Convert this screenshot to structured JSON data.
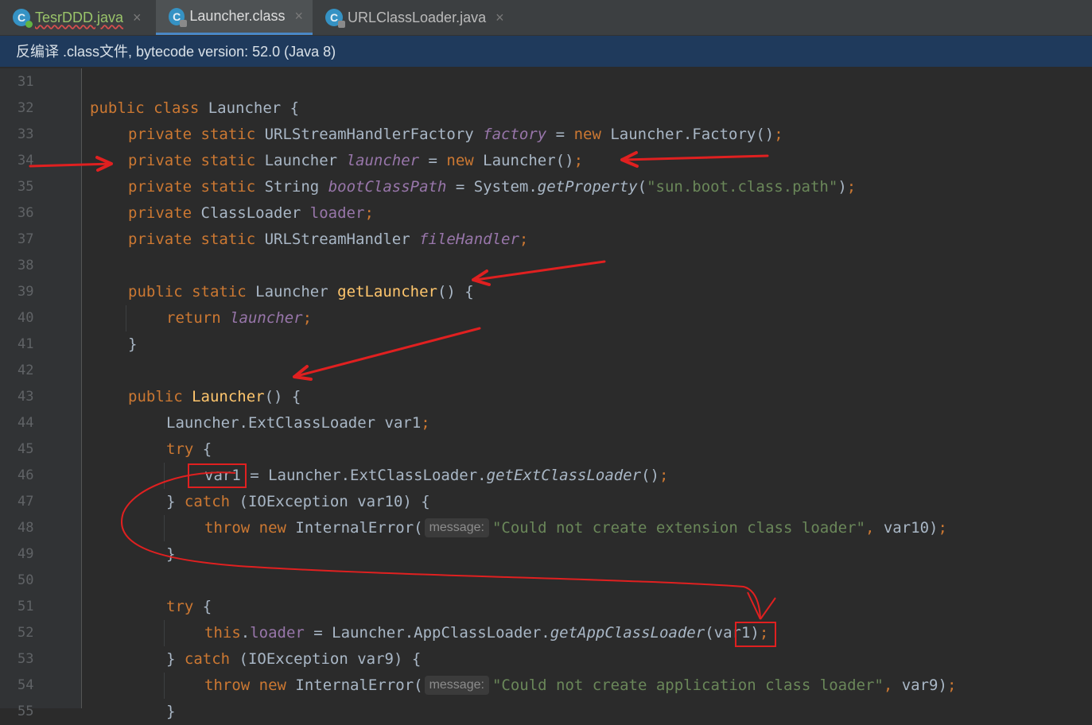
{
  "tabs": [
    {
      "label": "TesrDDD.java",
      "icon": "java-class-icon",
      "active": false
    },
    {
      "label": "Launcher.class",
      "icon": "class-icon",
      "active": true
    },
    {
      "label": "URLClassLoader.java",
      "icon": "class-icon",
      "active": false
    }
  ],
  "tab_close_glyph": "×",
  "banner": "反编译 .class文件, bytecode version: 52.0 (Java 8)",
  "line_numbers": [
    "31",
    "32",
    "33",
    "34",
    "35",
    "36",
    "37",
    "38",
    "39",
    "40",
    "41",
    "42",
    "43",
    "44",
    "45",
    "46",
    "47",
    "48",
    "49",
    "50",
    "51",
    "52",
    "53",
    "54",
    "55"
  ],
  "code": {
    "l32": {
      "kw1": "public",
      "kw2": "class",
      "rest": " Launcher {"
    },
    "l33": {
      "kw1": "private",
      "kw2": "static",
      "type": " URLStreamHandlerFactory ",
      "field": "factory",
      "eq": " = ",
      "new": "new",
      "rest": " Launcher.Factory()",
      "semi": ";"
    },
    "l34": {
      "kw1": "private",
      "kw2": "static",
      "type": " Launcher ",
      "field": "launcher",
      "eq": " = ",
      "new": "new",
      "rest": " Launcher()",
      "semi": ";"
    },
    "l35": {
      "kw1": "private",
      "kw2": "static",
      "type": " String ",
      "field": "bootClassPath",
      "eq": " = System.",
      "method": "getProperty",
      "open": "(",
      "str": "\"sun.boot.class.path\"",
      "close": ")",
      "semi": ";"
    },
    "l36": {
      "kw1": "private",
      "type": " ClassLoader ",
      "field": "loader",
      "semi": ";"
    },
    "l37": {
      "kw1": "private",
      "kw2": "static",
      "type": " URLStreamHandler ",
      "field": "fileHandler",
      "semi": ";"
    },
    "l39": {
      "kw1": "public",
      "kw2": "static",
      "type": " Launcher ",
      "fn": "getLauncher",
      "rest": "() {"
    },
    "l40": {
      "kw1": "return",
      "field": "launcher",
      "semi": ";"
    },
    "l41": {
      "rest": "}"
    },
    "l43": {
      "kw1": "public",
      "fn": "Launcher",
      "rest": "() {"
    },
    "l44": {
      "rest": "Launcher.ExtClassLoader var1",
      "semi": ";"
    },
    "l45": {
      "kw1": "try",
      "rest": " {"
    },
    "l46": {
      "var": "var1",
      "rest": " = Launcher.ExtClassLoader.",
      "method": "getExtClassLoader",
      "tail": "()",
      "semi": ";"
    },
    "l47": {
      "open": "} ",
      "kw1": "catch",
      "rest": " (IOException var10) {"
    },
    "l48": {
      "kw1": "throw",
      "kw2": "new",
      "rest": " InternalError(",
      "hint": "message:",
      "str": "\"Could not create extension class loader\"",
      "comma": ",",
      "tail": " var10)",
      "semi": ";"
    },
    "l49": {
      "rest": "}"
    },
    "l51": {
      "kw1": "try",
      "rest": " {"
    },
    "l52": {
      "kw1": "this",
      "dot": ".",
      "field": "loader",
      "rest": " = Launcher.AppClassLoader.",
      "method": "getAppClassLoader",
      "open": "(",
      "var": "var1",
      "close": ")",
      "semi": ";"
    },
    "l53": {
      "open": "} ",
      "kw1": "catch",
      "rest": " (IOException var9) {"
    },
    "l54": {
      "kw1": "throw",
      "kw2": "new",
      "rest": " InternalError(",
      "hint": "message:",
      "str": "\"Could not create application class loader\"",
      "comma": ",",
      "tail": " var9)",
      "semi": ";"
    },
    "l55": {
      "rest": "}"
    }
  },
  "colors": {
    "keyword": "#cc7832",
    "function": "#ffc66d",
    "string": "#6a8759",
    "field": "#9876aa",
    "annotation": "#e02020"
  }
}
